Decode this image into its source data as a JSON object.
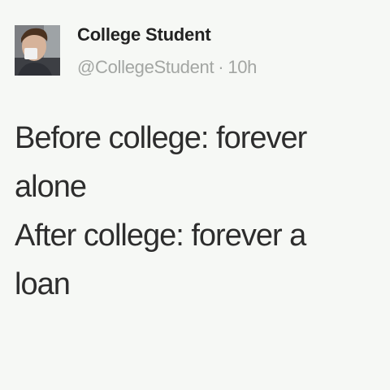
{
  "tweet": {
    "author": {
      "name": "College Student",
      "handle": "@CollegeStudent",
      "avatar_icon": "profile-photo-icon"
    },
    "timestamp": "10h",
    "separator": "·",
    "text_lines": [
      "Before college: forever",
      "alone",
      "After college: forever a",
      "loan"
    ]
  }
}
